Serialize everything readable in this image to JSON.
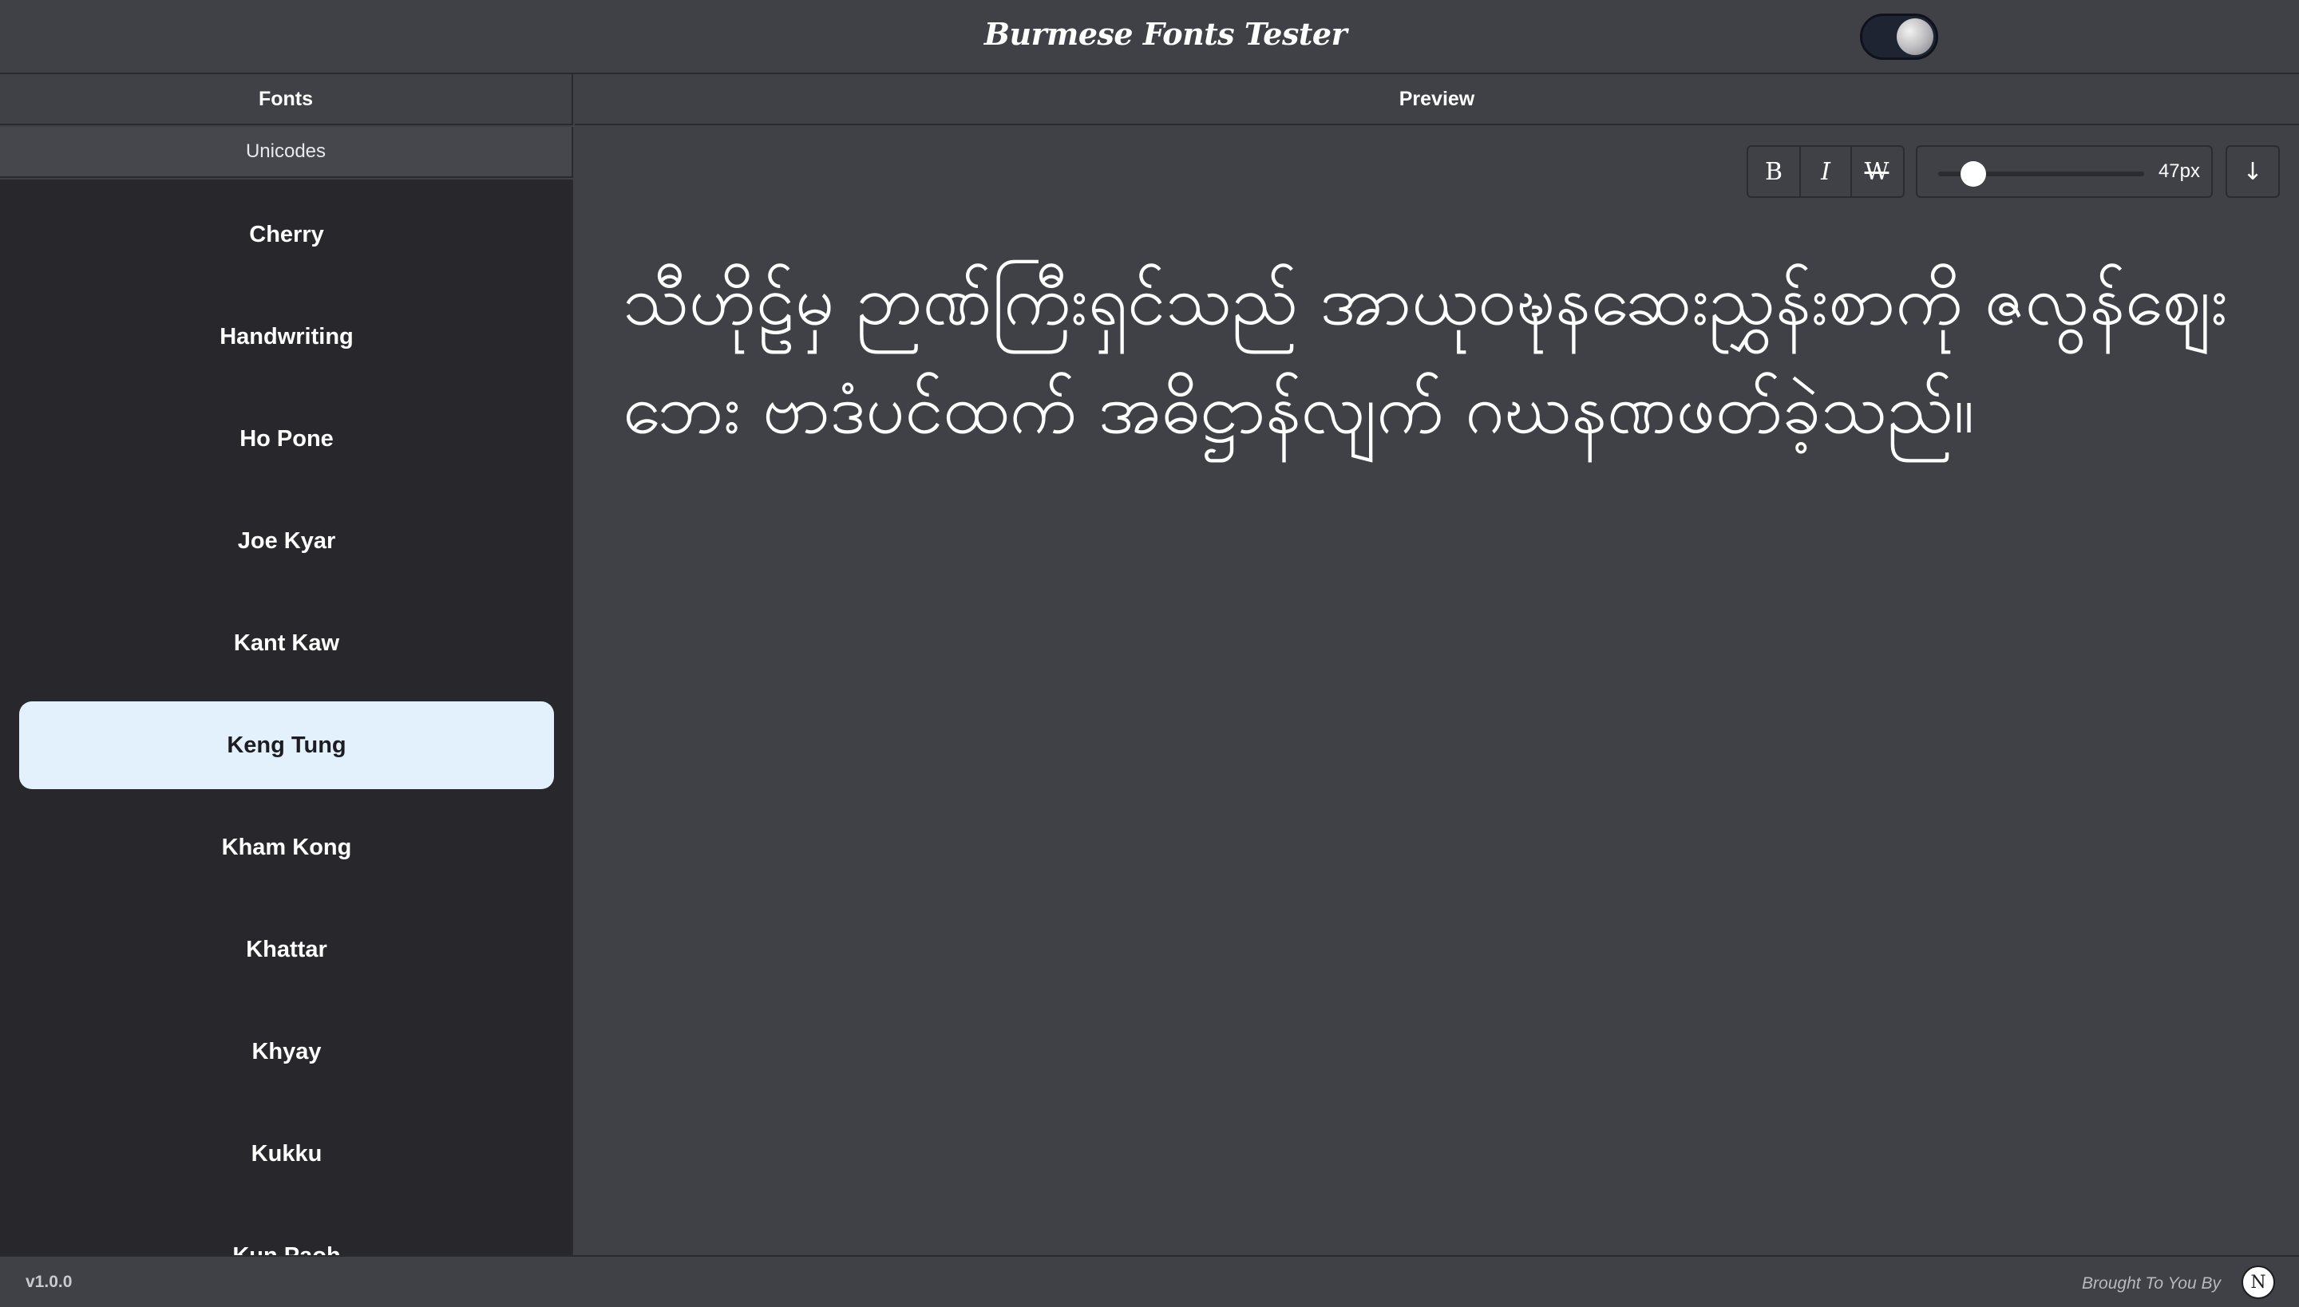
{
  "header": {
    "title": "Burmese Fonts Tester",
    "theme_toggle_icon": "theme-toggle-icon"
  },
  "panels": {
    "fonts_label": "Fonts",
    "preview_label": "Preview",
    "unicodes_tab": "Unicodes"
  },
  "sidebar": {
    "selected": "Keng Tung",
    "items": [
      {
        "label": "Cherry"
      },
      {
        "label": "Handwriting"
      },
      {
        "label": "Ho Pone"
      },
      {
        "label": "Joe Kyar"
      },
      {
        "label": "Kant Kaw"
      },
      {
        "label": "Keng Tung"
      },
      {
        "label": "Kham Kong"
      },
      {
        "label": "Khattar"
      },
      {
        "label": "Khyay"
      },
      {
        "label": "Kukku"
      },
      {
        "label": "Kun Paoh"
      }
    ]
  },
  "toolbar": {
    "bold_label": "B",
    "italic_label": "I",
    "strike_label": "W",
    "font_size_value": 47,
    "font_size_readout": "47px",
    "slider_fraction": 0.17,
    "download_icon": "arrow-down-icon",
    "download_glyph": "↓"
  },
  "preview": {
    "text": "သီဟိုဠ်မှ ဉာဏ်ကြီးရှင်သည် အာယုဝဍ္ဎနဆေးညွှန်းစာကို ဇလွန်ဈေးဘေး ဗာဒံပင်ထက် အဓိဋ္ဌာန်လျက် ဂဃနဏဖတ်ခဲ့သည်။"
  },
  "footer": {
    "version": "v1.0.0",
    "credit": "Brought To You By",
    "logo_letter": "N"
  },
  "colors": {
    "background": "#404047",
    "sidebar": "#28282c",
    "selected_item": "#e3f1fc",
    "toggle_track": "#1f2433"
  }
}
